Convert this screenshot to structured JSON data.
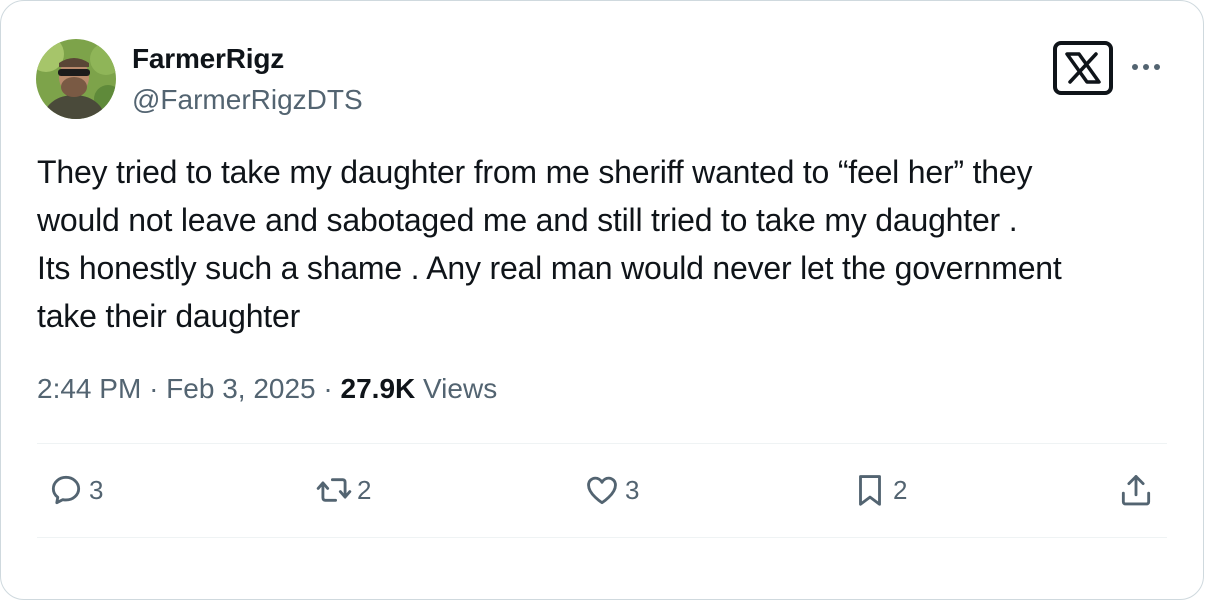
{
  "author": {
    "display_name": "FarmerRigz",
    "handle": "@FarmerRigzDTS"
  },
  "tweet": {
    "text": "They tried to take my daughter from me sheriff wanted to “feel her” they\nwould not leave and sabotaged me and still tried to take my daughter .\nIts honestly such a shame . Any real man would never let the government\ntake their daughter",
    "time": "2:44 PM",
    "sep1": "·",
    "date": "Feb 3, 2025",
    "sep2": "·",
    "views_count": "27.9K",
    "views_label": "Views"
  },
  "actions": {
    "reply_count": "3",
    "retweet_count": "2",
    "like_count": "3",
    "bookmark_count": "2"
  },
  "icons": {
    "reply": "reply-icon",
    "retweet": "retweet-icon",
    "like": "heart-icon",
    "bookmark": "bookmark-icon",
    "share": "share-icon",
    "logo": "x-logo-icon",
    "more": "more-icon"
  },
  "colors": {
    "text": "#0f1419",
    "secondary": "#536471",
    "border": "#cfd9de"
  }
}
